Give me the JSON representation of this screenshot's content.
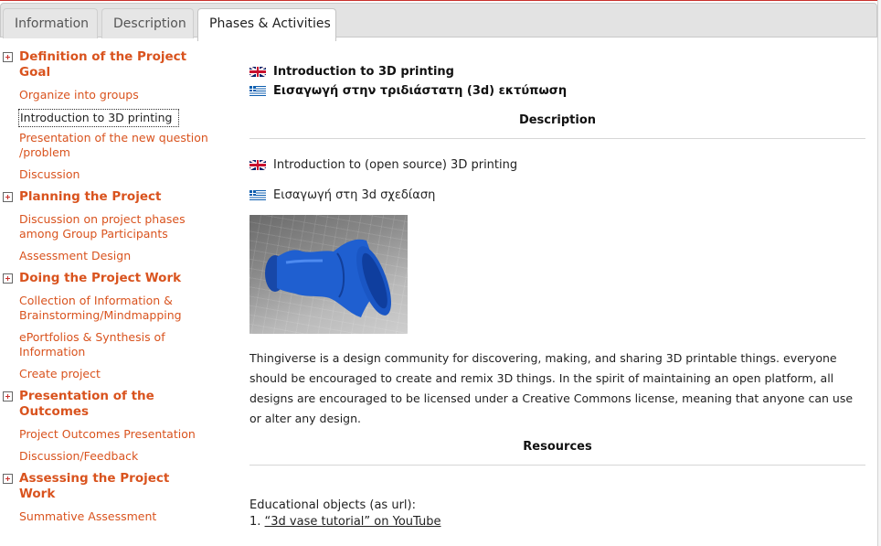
{
  "tabs": [
    {
      "label": "Information"
    },
    {
      "label": "Description"
    },
    {
      "label": "Phases & Activities"
    }
  ],
  "sidebar": {
    "phases": [
      {
        "title": "Definition of the Project Goal",
        "activities": [
          "Organize into groups",
          "Introduction to 3D printing",
          "Presentation of the new question /problem",
          "Discussion"
        ]
      },
      {
        "title": "Planning the Project",
        "activities": [
          "Discussion on project phases among Group Participants",
          "Assessment Design"
        ]
      },
      {
        "title": "Doing the Project Work",
        "activities": [
          "Collection of Information & Brainstorming/Mindmapping",
          "ePortfolios & Synthesis of Information",
          "Create project"
        ]
      },
      {
        "title": "Presentation of the Outcomes",
        "activities": [
          "Project Outcomes Presentation",
          "Discussion/Feedback"
        ]
      },
      {
        "title": "Assessing the Project Work",
        "activities": [
          "Summative Assessment"
        ]
      }
    ],
    "selected_activity": "Introduction to 3D printing"
  },
  "main": {
    "title_en": "Introduction to 3D printing",
    "title_gr": "Εισαγωγή στην τριδιάστατη (3d) εκτύπωση",
    "description_heading": "Description",
    "desc_en": "Introduction to (open source) 3D printing",
    "desc_gr": "Εισαγωγή στη 3d σχεδίαση",
    "paragraph": "Thingiverse is a design community for discovering, making, and sharing 3D printable things. everyone should be encouraged to create and remix 3D things. In the spirit of maintaining an open platform, all designs are encouraged to be licensed under a Creative Commons license, meaning that anyone can use or alter any design.",
    "resources_heading": "Resources",
    "objects_label": "Educational objects (as url):",
    "link_number": "1.",
    "link_text": "“3d vase tutorial” on YouTube"
  },
  "colors": {
    "accent": "#d9531e",
    "vase": "#1f5fd0"
  },
  "icons": [
    "uk-flag-icon",
    "greek-flag-icon",
    "expand-plus-icon"
  ]
}
